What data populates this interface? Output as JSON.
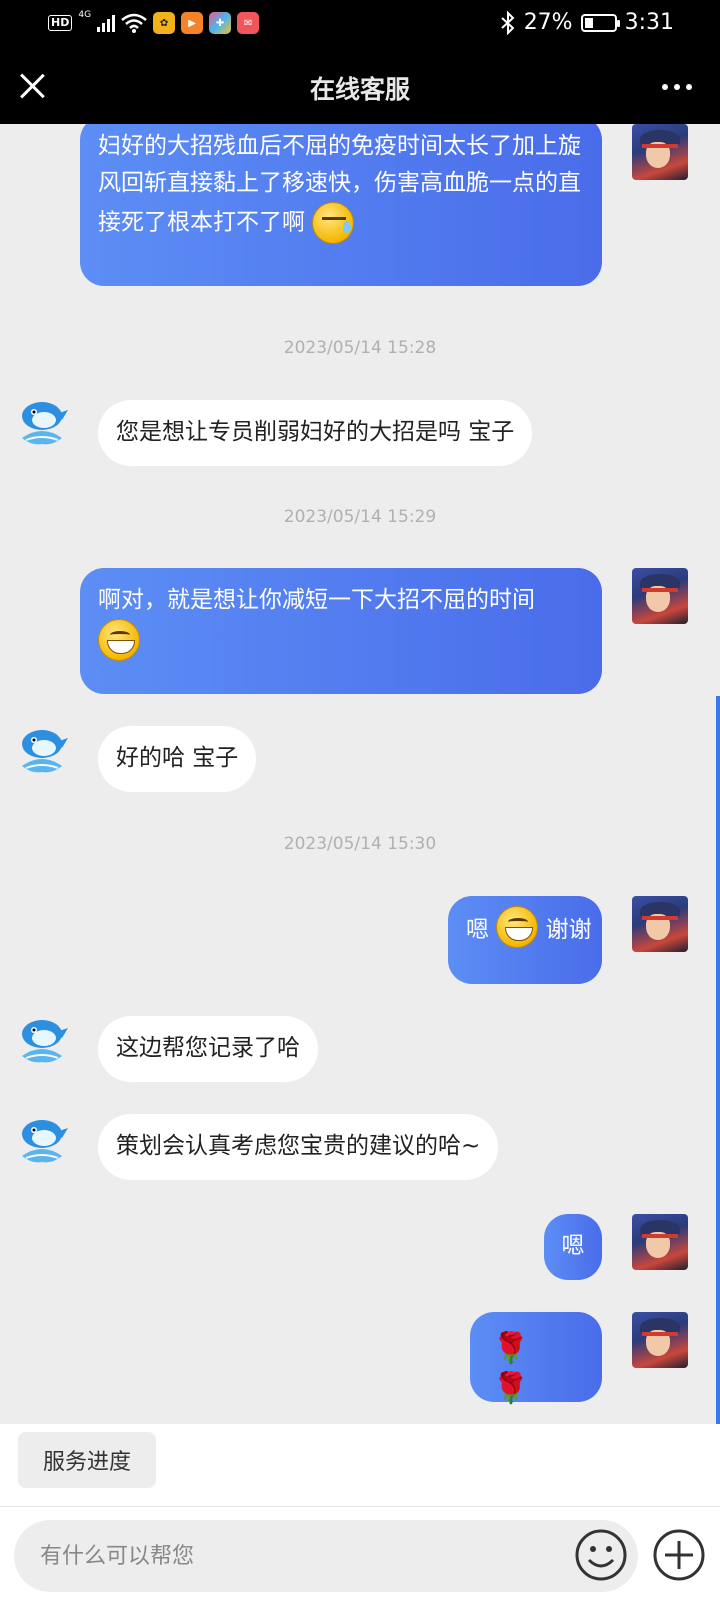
{
  "status_bar": {
    "hd_label": "HD",
    "network_label": "4G",
    "battery_percent": "27%",
    "battery_level": 0.27,
    "time": "3:31"
  },
  "header": {
    "title": "在线客服"
  },
  "messages": [
    {
      "id": "m1",
      "side": "out",
      "text": "妇好的大招残血后不屈的免疫时间太长了加上旋风回斩直接黏上了移速快，伤害高血脆一点的直接死了根本打不了啊",
      "emoji": "sweat-icon"
    },
    {
      "id": "t1",
      "timestamp": "2023/05/14 15:28"
    },
    {
      "id": "m2",
      "side": "in",
      "text": "您是想让专员削弱妇好的大招是吗 宝子"
    },
    {
      "id": "t2",
      "timestamp": "2023/05/14 15:29"
    },
    {
      "id": "m3",
      "side": "out",
      "text": "啊对，就是想让你减短一下大招不屈的时间",
      "emoji": "grin-icon"
    },
    {
      "id": "m4",
      "side": "in",
      "text": "好的哈 宝子"
    },
    {
      "id": "t3",
      "timestamp": "2023/05/14 15:30"
    },
    {
      "id": "m5",
      "side": "out",
      "text_before": "嗯",
      "text_after": "谢谢",
      "emoji": "grin-icon"
    },
    {
      "id": "m6",
      "side": "in",
      "text": "这边帮您记录了哈"
    },
    {
      "id": "m7",
      "side": "in",
      "text": "策划会认真考虑您宝贵的建议的哈~"
    },
    {
      "id": "m8",
      "side": "out",
      "text": "嗯"
    },
    {
      "id": "m9",
      "side": "out",
      "emoji": "rose-icon",
      "count": 2
    }
  ],
  "quick_actions": {
    "service_progress": "服务进度"
  },
  "composer": {
    "placeholder": "有什么可以帮您"
  },
  "colors": {
    "outgoing_start": "#5c8ef5",
    "outgoing_end": "#4a6cea",
    "incoming": "#ffffff",
    "background": "#ededed",
    "accent": "#3a78f0"
  }
}
